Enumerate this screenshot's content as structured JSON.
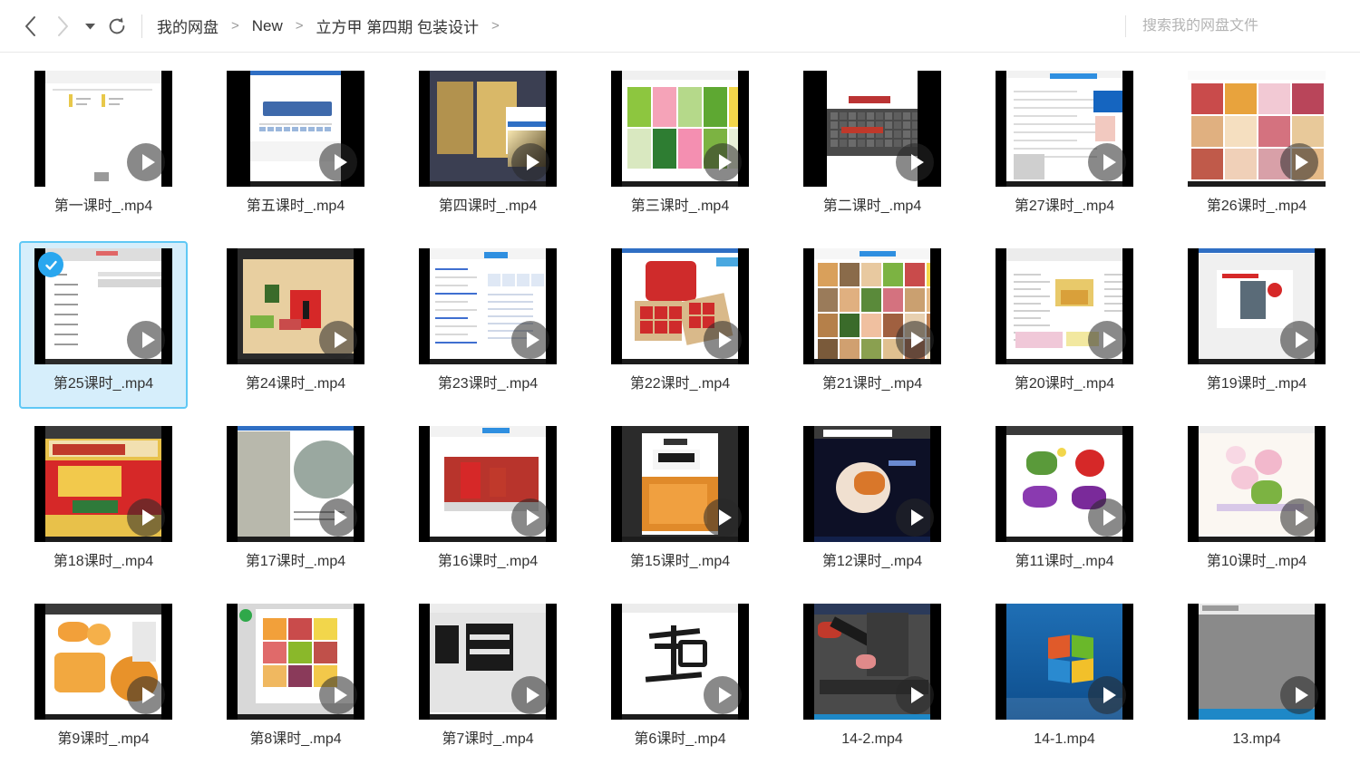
{
  "header": {
    "nav": {
      "back_label": "后退",
      "forward_label": "前进",
      "history_label": "历史记录",
      "refresh_label": "刷新"
    },
    "breadcrumb": {
      "items": [
        "我的网盘",
        "New",
        "立方甲 第四期 包装设计"
      ],
      "separator": ">",
      "trailing_separator": ">"
    },
    "search": {
      "placeholder": "搜索我的网盘文件",
      "value": ""
    }
  },
  "files": [
    {
      "name": "第一课时_.mp4",
      "selected": false,
      "scene": "doc-white",
      "box": "mid"
    },
    {
      "name": "第五课时_.mp4",
      "selected": false,
      "scene": "ppt-title",
      "box": "narrow"
    },
    {
      "name": "第四课时_.mp4",
      "selected": false,
      "scene": "ps-dark-cjk",
      "box": "mid"
    },
    {
      "name": "第三课时_.mp4",
      "selected": false,
      "scene": "browser-grid",
      "box": "mid"
    },
    {
      "name": "第二课时_.mp4",
      "selected": false,
      "scene": "keyboard",
      "box": "narrow"
    },
    {
      "name": "第27课时_.mp4",
      "selected": false,
      "scene": "article",
      "box": "mid"
    },
    {
      "name": "第26课时_.mp4",
      "selected": false,
      "scene": "food-grid",
      "box": "wide"
    },
    {
      "name": "第25课时_.mp4",
      "selected": true,
      "scene": "form-doc",
      "box": "mid"
    },
    {
      "name": "第24课时_.mp4",
      "selected": false,
      "scene": "ps-poster",
      "box": "mid"
    },
    {
      "name": "第23课时_.mp4",
      "selected": false,
      "scene": "webpage-blue",
      "box": "mid"
    },
    {
      "name": "第22课时_.mp4",
      "selected": false,
      "scene": "redbox",
      "box": "mid"
    },
    {
      "name": "第21课时_.mp4",
      "selected": false,
      "scene": "product-grid",
      "box": "mid"
    },
    {
      "name": "第20课时_.mp4",
      "selected": false,
      "scene": "doc-illus",
      "box": "mid"
    },
    {
      "name": "第19课时_.mp4",
      "selected": false,
      "scene": "slide-pack",
      "box": "mid"
    },
    {
      "name": "第18课时_.mp4",
      "selected": false,
      "scene": "walnut",
      "box": "mid"
    },
    {
      "name": "第17课时_.mp4",
      "selected": false,
      "scene": "stone-slide",
      "box": "mid"
    },
    {
      "name": "第16课时_.mp4",
      "selected": false,
      "scene": "red-dolls",
      "box": "mid"
    },
    {
      "name": "第15课时_.mp4",
      "selected": false,
      "scene": "snack-pack",
      "box": "mid"
    },
    {
      "name": "第12课时_.mp4",
      "selected": false,
      "scene": "dark-render",
      "box": "mid"
    },
    {
      "name": "第11课时_.mp4",
      "selected": false,
      "scene": "veggies",
      "box": "mid"
    },
    {
      "name": "第10课时_.mp4",
      "selected": false,
      "scene": "lilies",
      "box": "mid"
    },
    {
      "name": "第9课时_.mp4",
      "selected": false,
      "scene": "oranges",
      "box": "mid"
    },
    {
      "name": "第8课时_.mp4",
      "selected": false,
      "scene": "fruit-sheet",
      "box": "mid"
    },
    {
      "name": "第7课时_.mp4",
      "selected": false,
      "scene": "cjk-glyph-2",
      "box": "mid"
    },
    {
      "name": "第6课时_.mp4",
      "selected": false,
      "scene": "cjk-glyph",
      "box": "mid"
    },
    {
      "name": "14-2.mp4",
      "selected": false,
      "scene": "c4d",
      "box": "mid"
    },
    {
      "name": "14-1.mp4",
      "selected": false,
      "scene": "win7",
      "box": "mid"
    },
    {
      "name": "13.mp4",
      "selected": false,
      "scene": "grey-screen",
      "box": "mid"
    }
  ],
  "colors": {
    "selection_bg": "#d6eefb",
    "selection_border": "#5fc8f5",
    "check_badge": "#2aa7ef",
    "text": "#333333",
    "muted_text": "#b4b4b4",
    "thumb_letterbox": "#000000"
  }
}
